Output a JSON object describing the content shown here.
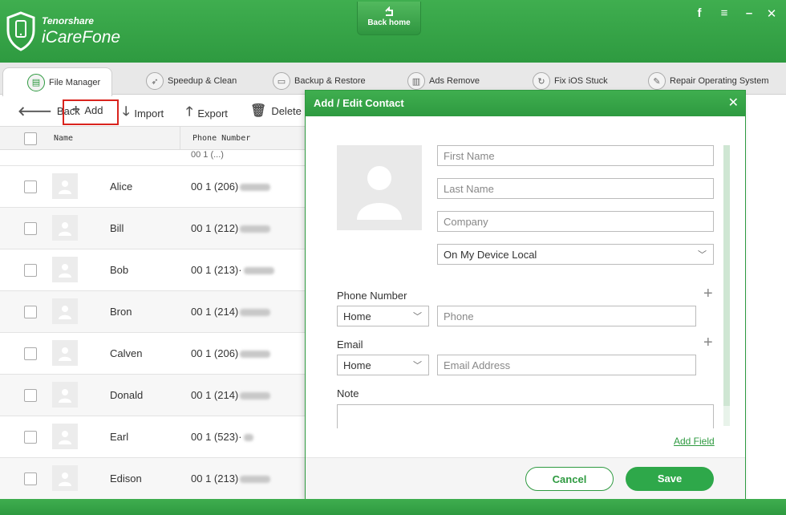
{
  "app": {
    "brand_small": "Tenorshare",
    "brand_name": "iCareFone",
    "back_home": "Back home",
    "accent": "#2e9a40"
  },
  "window_controls": [
    "f",
    "≡",
    "–",
    "✕"
  ],
  "tabs": [
    {
      "label": "File Manager",
      "icon": "file-manager-icon",
      "active": true
    },
    {
      "label": "Speedup & Clean",
      "icon": "rocket-icon"
    },
    {
      "label": "Backup & Restore",
      "icon": "folder-icon"
    },
    {
      "label": "Ads Remove",
      "icon": "trash-icon"
    },
    {
      "label": "Fix iOS Stuck",
      "icon": "refresh-icon"
    },
    {
      "label": "Repair Operating System",
      "icon": "wrench-icon"
    }
  ],
  "toolbar": {
    "back": "Back",
    "add": "Add",
    "import": "Import",
    "export": "Export",
    "delete": "Delete"
  },
  "table": {
    "col_name": "Name",
    "col_phone": "Phone Number",
    "partial_row_phone": "00 1 (...)",
    "rows": [
      {
        "name": "Alice",
        "phone": "00 1 (206)"
      },
      {
        "name": "Bill",
        "phone": "00 1 (212)"
      },
      {
        "name": "Bob",
        "phone": "00 1 (213)·"
      },
      {
        "name": "Bron",
        "phone": "00 1 (214)"
      },
      {
        "name": "Calven",
        "phone": "00 1 (206)"
      },
      {
        "name": "Donald",
        "phone": "00 1 (214)"
      },
      {
        "name": "Earl",
        "phone": "00 1 (523)·"
      },
      {
        "name": "Edison",
        "phone": "00 1 (213)"
      }
    ]
  },
  "dialog": {
    "title": "Add / Edit Contact",
    "first_name_placeholder": "First Name",
    "last_name_placeholder": "Last Name",
    "company_placeholder": "Company",
    "account_select": "On My Device Local",
    "phone_label": "Phone Number",
    "phone_type": "Home",
    "phone_placeholder": "Phone",
    "email_label": "Email",
    "email_type": "Home",
    "email_placeholder": "Email Address",
    "note_label": "Note",
    "add_field": "Add Field",
    "cancel": "Cancel",
    "save": "Save"
  }
}
